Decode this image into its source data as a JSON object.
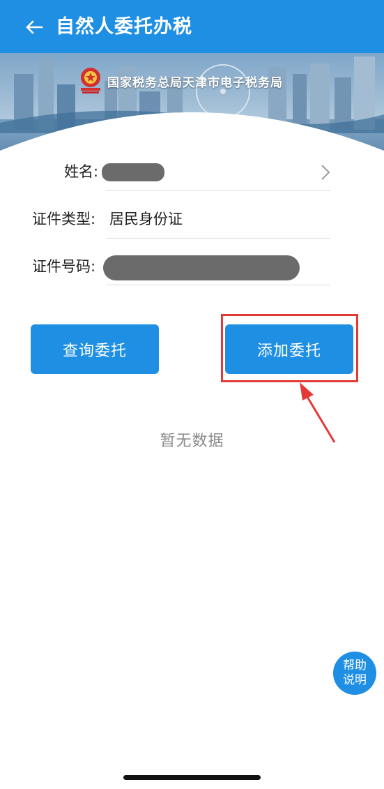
{
  "header": {
    "title": "自然人委托办税",
    "back_icon": "back-arrow-icon"
  },
  "banner": {
    "agency": "国家税务总局天津市电子税务局",
    "emblem_icon": "national-emblem-icon"
  },
  "form": {
    "name_label": "姓名:",
    "id_type_label": "证件类型:",
    "id_type_value": "居民身份证",
    "id_number_label": "证件号码:",
    "name_chevron_icon": "chevron-right-icon"
  },
  "actions": {
    "query_label": "查询委托",
    "add_label": "添加委托"
  },
  "empty_text": "暂无数据",
  "help": {
    "line1": "帮助",
    "line2": "说明"
  },
  "colors": {
    "primary": "#1f8fe4",
    "annotation": "#e53935",
    "muted_text": "#8a8a8a"
  }
}
